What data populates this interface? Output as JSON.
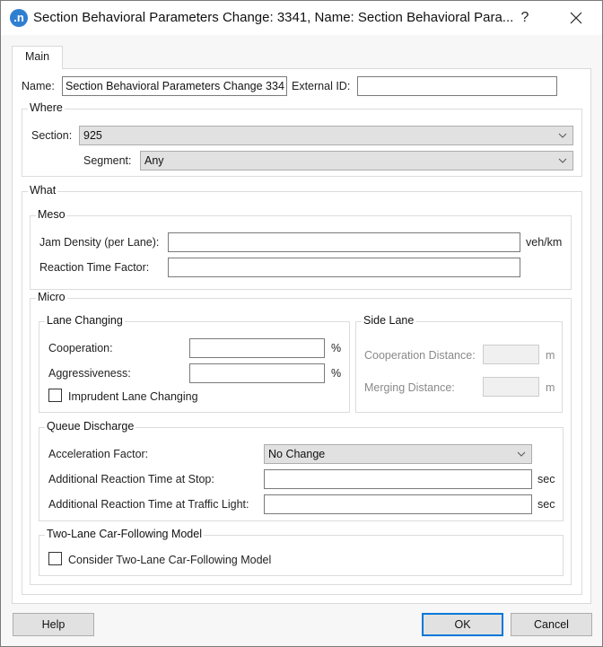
{
  "window": {
    "title": "Section Behavioral Parameters Change: 3341, Name: Section Behavioral Para...",
    "app_icon_glyph": ".n",
    "help_glyph": "?",
    "close_icon": "close-icon"
  },
  "tabs": [
    {
      "label": "Main",
      "active": true
    }
  ],
  "main": {
    "name_label": "Name:",
    "name_value": "Section Behavioral Parameters Change 334",
    "external_id_label": "External ID:",
    "external_id_value": ""
  },
  "where": {
    "title": "Where",
    "section_label": "Section:",
    "section_value": "925",
    "segment_label": "Segment:",
    "segment_value": "Any"
  },
  "what": {
    "title": "What",
    "meso": {
      "title": "Meso",
      "jam_density_label": "Jam Density (per Lane):",
      "jam_density_value": "",
      "jam_density_unit": "veh/km",
      "reaction_time_factor_label": "Reaction Time Factor:",
      "reaction_time_factor_value": ""
    },
    "micro": {
      "title": "Micro",
      "lane_changing": {
        "title": "Lane Changing",
        "cooperation_label": "Cooperation:",
        "cooperation_value": "",
        "cooperation_unit": "%",
        "aggressiveness_label": "Aggressiveness:",
        "aggressiveness_value": "",
        "aggressiveness_unit": "%",
        "imprudent_label": "Imprudent Lane Changing",
        "imprudent_checked": false
      },
      "side_lane": {
        "title": "Side Lane",
        "cooperation_distance_label": "Cooperation Distance:",
        "cooperation_distance_value": "",
        "cooperation_distance_unit": "m",
        "merging_distance_label": "Merging Distance:",
        "merging_distance_value": "",
        "merging_distance_unit": "m"
      },
      "queue_discharge": {
        "title": "Queue Discharge",
        "acceleration_factor_label": "Acceleration Factor:",
        "acceleration_factor_value": "No Change",
        "reaction_stop_label": "Additional Reaction Time at Stop:",
        "reaction_stop_value": "",
        "reaction_stop_unit": "sec",
        "reaction_light_label": "Additional Reaction Time at Traffic Light:",
        "reaction_light_value": "",
        "reaction_light_unit": "sec"
      },
      "two_lane": {
        "title": "Two-Lane Car-Following Model",
        "consider_label": "Consider Two-Lane Car-Following Model",
        "consider_checked": false
      }
    }
  },
  "buttons": {
    "help": "Help",
    "ok": "OK",
    "cancel": "Cancel"
  },
  "colors": {
    "accent": "#0078d7",
    "app_icon": "#2f7fd1"
  }
}
